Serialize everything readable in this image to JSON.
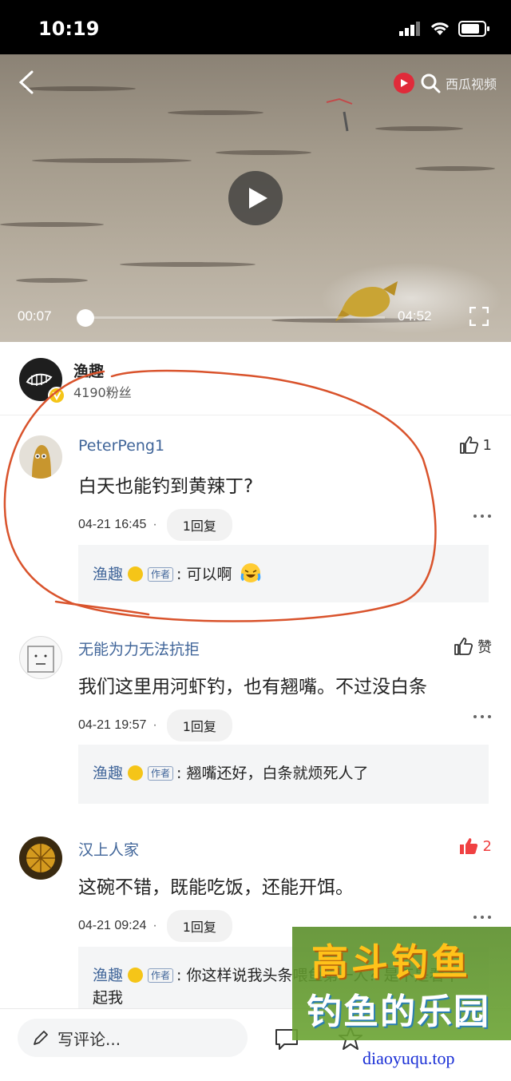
{
  "status_bar": {
    "time": "10:19"
  },
  "video": {
    "brand": "西瓜视频",
    "current_time": "00:07",
    "total_time": "04:52",
    "progress_fraction": 0.024
  },
  "author": {
    "name": "渔趣",
    "fans": "4190粉丝"
  },
  "comments": [
    {
      "user": "PeterPeng1",
      "likes": "1",
      "liked": false,
      "text": "白天也能钓到黄辣丁?",
      "time": "04-21 16:45",
      "dot": "·",
      "reply_count": "1回复",
      "reply": {
        "author": "渔趣",
        "tag": "作者",
        "text": ": 可以啊"
      }
    },
    {
      "user": "无能为力无法抗拒",
      "likes": "赞",
      "liked": false,
      "text": "我们这里用河虾钓，也有翘嘴。不过没白条",
      "time": "04-21 19:57",
      "dot": "·",
      "reply_count": "1回复",
      "reply": {
        "author": "渔趣",
        "tag": "作者",
        "text": ": 翘嘴还好，白条就烦死人了"
      }
    },
    {
      "user": "汉上人家",
      "likes": "2",
      "liked": true,
      "text": "这碗不错，既能吃饭，还能开饵。",
      "time": "04-21 09:24",
      "dot": "·",
      "reply_count": "1回复",
      "reply": {
        "author": "渔趣",
        "tag": "作者",
        "text": ": 你这样说我头条喂鱼第一人？是不是看不起我"
      }
    }
  ],
  "bottom_bar": {
    "placeholder": "写评论..."
  },
  "watermark": {
    "line1": "高斗钓鱼",
    "line2": "钓鱼的乐园",
    "url": "diaoyuqu.top"
  },
  "colors": {
    "accent_link": "#406599",
    "like_red": "#f04142",
    "annotation_red": "#d9532c",
    "verified_yellow": "#f5c518"
  },
  "icons": [
    "back-icon",
    "search-icon",
    "play-icon",
    "fullscreen-icon",
    "thumb-up-icon",
    "more-icon",
    "pencil-icon",
    "comment-icon",
    "star-icon",
    "verified-icon",
    "crying-laugh-emoji"
  ]
}
